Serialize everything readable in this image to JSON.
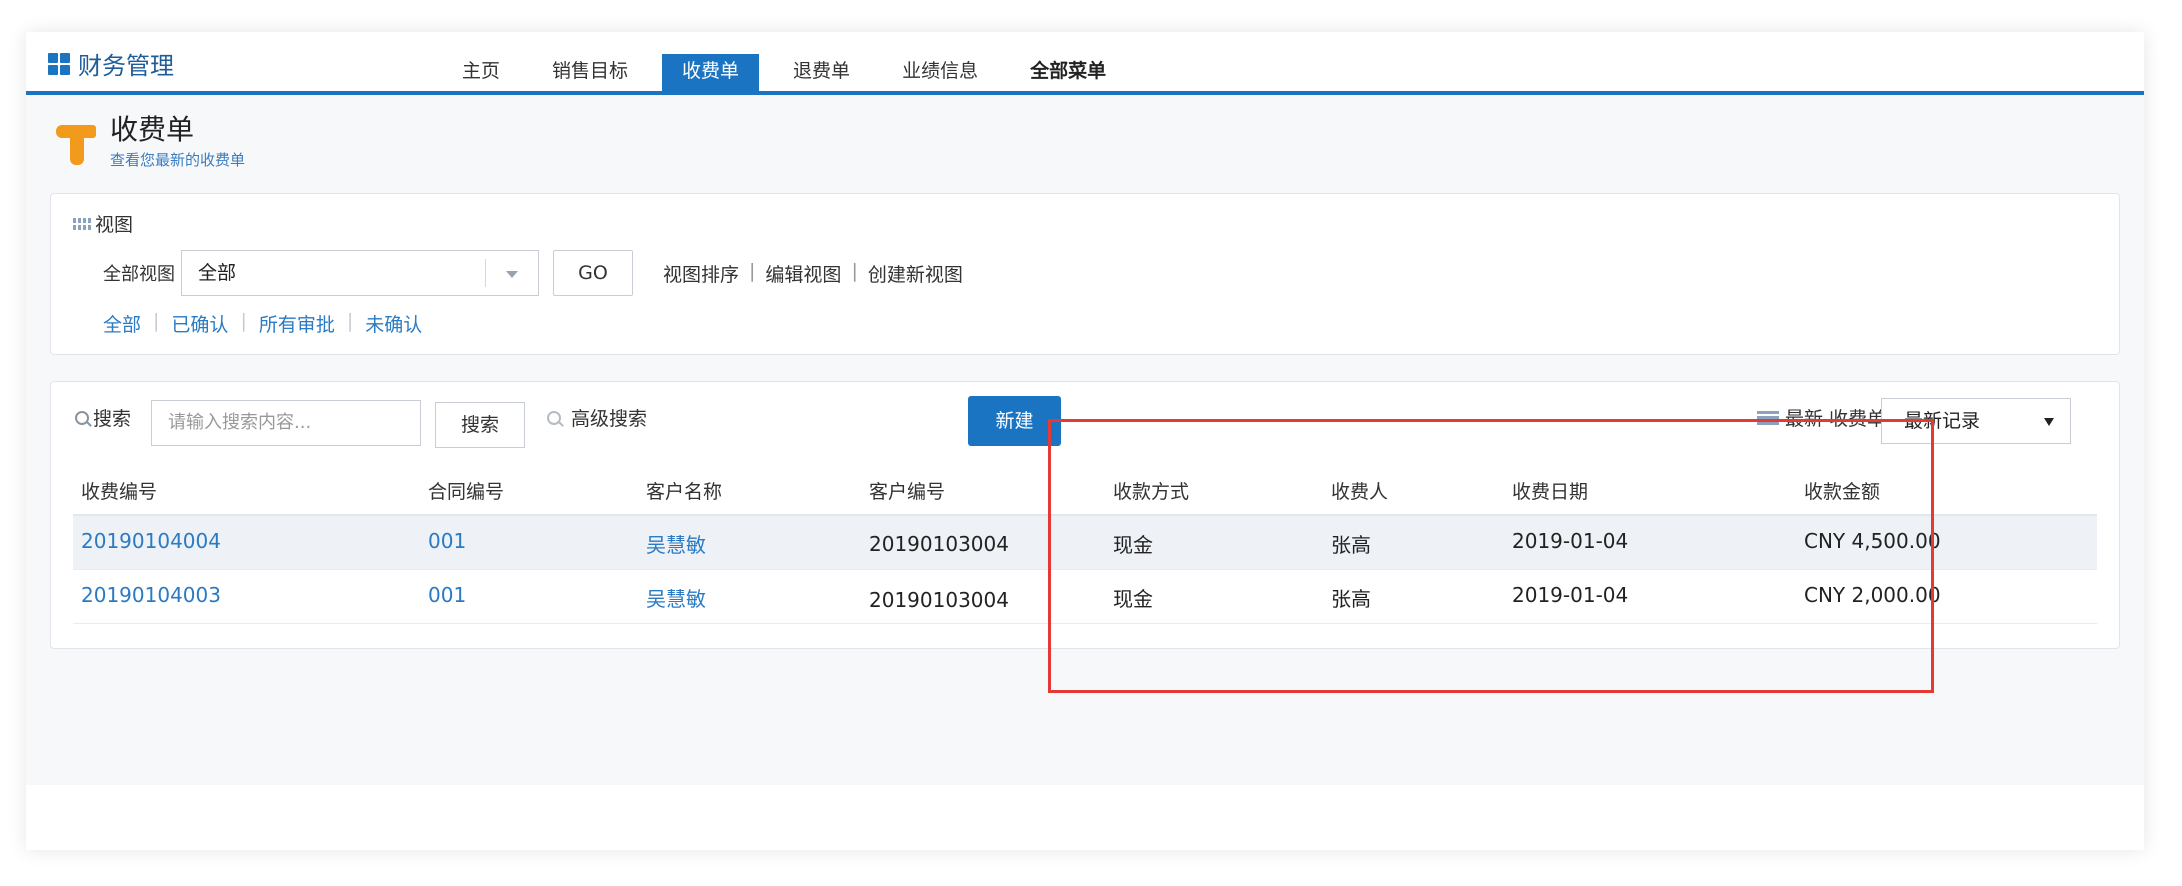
{
  "header": {
    "brand_title": "财务管理",
    "tabs": [
      {
        "label": "主页",
        "active": false
      },
      {
        "label": "销售目标",
        "active": false
      },
      {
        "label": "收费单",
        "active": true
      },
      {
        "label": "退费单",
        "active": false
      },
      {
        "label": "业绩信息",
        "active": false
      },
      {
        "label": "全部菜单",
        "active": false,
        "bold": true
      }
    ]
  },
  "page": {
    "title": "收费单",
    "subtitle": "查看您最新的收费单"
  },
  "view_panel": {
    "heading": "视图",
    "view_label": "全部视图",
    "view_value": "全部",
    "go_label": "GO",
    "actions": [
      "视图排序",
      "编辑视图",
      "创建新视图"
    ],
    "filters": [
      "全部",
      "已确认",
      "所有审批",
      "未确认"
    ]
  },
  "list_panel": {
    "search_label": "搜索",
    "search_placeholder": "请输入搜索内容...",
    "search_button": "搜索",
    "advanced_search": "高级搜索",
    "new_button": "新建",
    "recent_label": "最新 收费单",
    "recent_value": "最新记录"
  },
  "table": {
    "columns": [
      "收费编号",
      "合同编号",
      "客户名称",
      "客户编号",
      "收款方式",
      "收费人",
      "收费日期",
      "收款金额"
    ],
    "rows": [
      [
        "20190104004",
        "001",
        "吴慧敏",
        "20190103004",
        "现金",
        "张高",
        "2019-01-04",
        "CNY 4,500.00"
      ],
      [
        "20190104003",
        "001",
        "吴慧敏",
        "20190103004",
        "现金",
        "张高",
        "2019-01-04",
        "CNY 2,000.00"
      ]
    ]
  },
  "colors": {
    "accent": "#1b74c2",
    "link": "#2a7ac4",
    "logo": "#f29a1b",
    "highlight": "#e53935"
  }
}
